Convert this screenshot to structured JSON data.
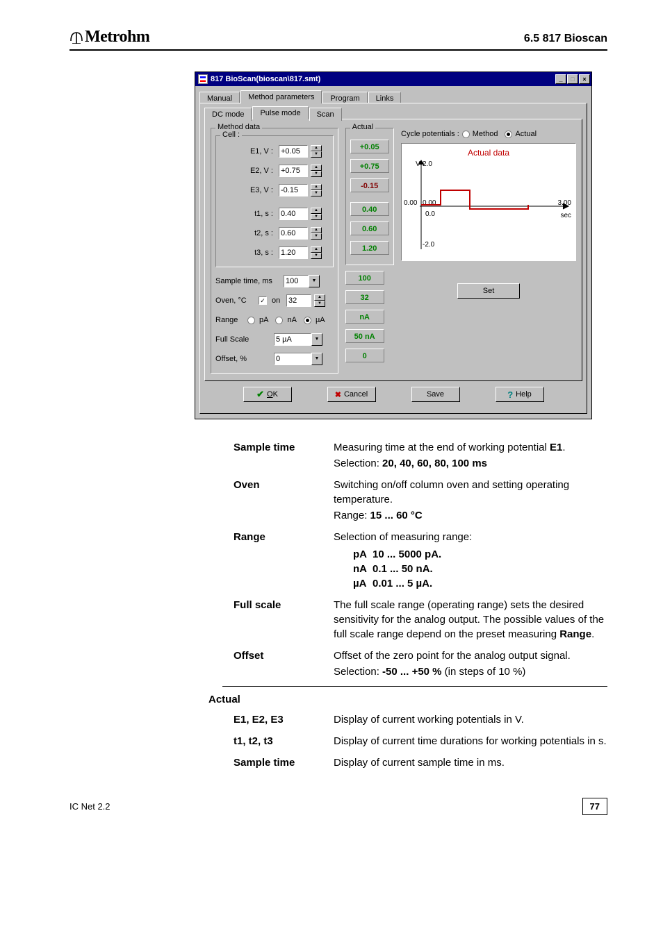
{
  "header": {
    "brand": "Metrohm",
    "section": "6.5  817 Bioscan"
  },
  "win": {
    "title": "817 BioScan(bioscan\\817.smt)",
    "tabs": [
      "Manual",
      "Method parameters",
      "Program",
      "Links"
    ],
    "tabs_active": 1,
    "subtabs": [
      "DC mode",
      "Pulse mode",
      "Scan"
    ],
    "subtabs_active": 1,
    "method_legend": "Method data",
    "cell_legend": "Cell :",
    "actual_legend": "Actual",
    "fields": {
      "e1": {
        "label": "E1, V :",
        "val": "+0.05",
        "act": "+0.05",
        "act_neg": false
      },
      "e2": {
        "label": "E2, V :",
        "val": "+0.75",
        "act": "+0.75",
        "act_neg": false
      },
      "e3": {
        "label": "E3, V :",
        "val": "-0.15",
        "act": "-0.15",
        "act_neg": true
      },
      "t1": {
        "label": "t1, s :",
        "val": "0.40",
        "act": "0.40",
        "act_neg": false
      },
      "t2": {
        "label": "t2, s :",
        "val": "0.60",
        "act": "0.60",
        "act_neg": false
      },
      "t3": {
        "label": "t3, s :",
        "val": "1.20",
        "act": "1.20",
        "act_neg": false
      }
    },
    "sample": {
      "label": "Sample time, ms",
      "val": "100",
      "act": "100"
    },
    "oven": {
      "label": "Oven, °C",
      "on_label": "on",
      "checked": true,
      "val": "32",
      "act": "32"
    },
    "range": {
      "label": "Range",
      "opts": [
        "pA",
        "nA",
        "µA"
      ],
      "sel": 2,
      "act": "nA"
    },
    "fs": {
      "label": "Full Scale",
      "val": "5 µA",
      "act": "50 nA"
    },
    "offset": {
      "label": "Offset, %",
      "val": "0",
      "act": "0"
    },
    "cycle": {
      "label": "Cycle potentials :",
      "opts": [
        "Method",
        "Actual"
      ],
      "sel": 1
    },
    "chart": {
      "title": "Actual data",
      "y_axis_label": "V",
      "y_top": "2.0",
      "y_bot": "-2.0",
      "x_left": "0.00",
      "x_origin": "0.00",
      "x_right": "3.00",
      "y_origin": "0.0",
      "x_unit": "sec"
    },
    "buttons": {
      "set": "Set",
      "ok": "OK",
      "cancel": "Cancel",
      "save": "Save",
      "help": "Help"
    }
  },
  "docs": {
    "items": [
      {
        "term": "Sample time",
        "def": "Measuring time at the end of working potential <b>E1</b>.",
        "sel": "Selection: <b>20, 40, 60, 80, 100 ms</b>"
      },
      {
        "term": "Oven",
        "def": "Switching on/off column oven and setting operating temperature.",
        "sel": "Range: <b>15 ... 60 °C</b>"
      },
      {
        "term": "Range",
        "def": "Selection of measuring range:",
        "tbl": [
          {
            "k": "pA",
            "v": "10 ... 5000 pA."
          },
          {
            "k": "nA",
            "v": "0.1 ... 50 nA."
          },
          {
            "k": "µA",
            "v": "0.01 ... 5 µA."
          }
        ]
      },
      {
        "term": "Full scale",
        "def": "The full scale range (operating range) sets the desired sensitivity for the analog output. The possible values of the full scale range depend on the preset measuring <b>Range</b>."
      },
      {
        "term": "Offset",
        "def": "Offset of the zero point for the analog output signal.",
        "sel": "Selection: <b>-50 ... +50 %</b> (in steps of 10 %)"
      }
    ],
    "group2": "Actual",
    "items2": [
      {
        "term": "E1, E2, E3",
        "def": "Display of current working potentials in V."
      },
      {
        "term": "t1, t2, t3",
        "def": "Display of current time durations for working potentials in s."
      },
      {
        "term": "Sample time",
        "def": "Display of current sample time in ms."
      }
    ]
  },
  "chart_data": {
    "type": "line",
    "title": "Actual data",
    "xlabel": "sec",
    "ylabel": "V",
    "xlim": [
      0.0,
      3.0
    ],
    "ylim": [
      -2.0,
      2.0
    ],
    "x": [
      0.0,
      0.4,
      0.4,
      1.0,
      1.0,
      2.2,
      2.2
    ],
    "y": [
      0.05,
      0.05,
      0.75,
      0.75,
      -0.15,
      -0.15,
      0.05
    ]
  },
  "footer": {
    "left": "IC Net 2.2",
    "page": "77"
  }
}
